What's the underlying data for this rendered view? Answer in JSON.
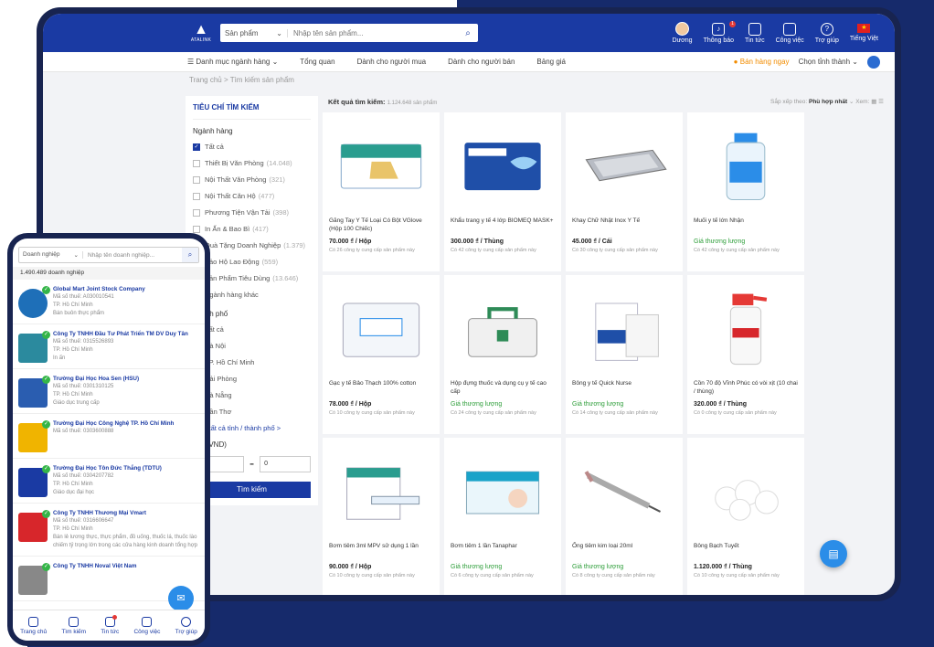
{
  "header": {
    "logo": "ATALINK",
    "search_category": "Sản phẩm",
    "search_placeholder": "Nhập tên sản phẩm...",
    "user": "Dương",
    "notifications": "Thông báo",
    "notification_count": "1",
    "news": "Tin tức",
    "jobs": "Công việc",
    "help": "Trợ giúp",
    "language": "Tiếng Việt"
  },
  "nav": {
    "items": [
      "Danh mục ngành hàng",
      "Tổng quan",
      "Dành cho người mua",
      "Dành cho người bán",
      "Bảng giá"
    ],
    "sell": "Bán hàng ngay",
    "city": "Chọn tỉnh thành"
  },
  "breadcrumb": "Trang chủ > Tìm kiếm sản phẩm",
  "filter": {
    "title": "TIÊU CHÍ TÌM KIẾM",
    "industry_label": "Ngành hàng",
    "all": "Tất cả",
    "industries": [
      {
        "name": "Thiết Bị Văn Phòng",
        "count": "(14.048)"
      },
      {
        "name": "Nội Thất Văn Phòng",
        "count": "(321)"
      },
      {
        "name": "Nội Thất Căn Hộ",
        "count": "(477)"
      },
      {
        "name": "Phương Tiện Vận Tải",
        "count": "(398)"
      },
      {
        "name": "In Ấn & Bao Bì",
        "count": "(417)"
      },
      {
        "name": "Quà Tặng Doanh Nghiệp",
        "count": "(1.379)"
      },
      {
        "name": "Bảo Hộ Lao Động",
        "count": "(559)"
      },
      {
        "name": "Sản Phẩm Tiêu Dùng",
        "count": "(13.646)"
      }
    ],
    "other_industry": "Ngành hàng khác",
    "city_label": "Thành phố",
    "cities": [
      "Tất cả",
      "Hà Nội",
      "TP. Hồ Chí Minh",
      "Hải Phòng",
      "Đà Nẵng",
      "Cần Thơ"
    ],
    "view_all_cities": "Xem tất cả tỉnh / thành phố >",
    "price_label": "Giá (VND)",
    "price_to": "0",
    "submit": "Tìm kiếm"
  },
  "results": {
    "label": "Kết quả tìm kiếm:",
    "count": "1.124.648 sản phẩm",
    "sort_label": "Sắp xếp theo:",
    "sort_value": "Phù hợp nhất",
    "view_label": "Xem:"
  },
  "products": [
    {
      "name": "Găng Tay Y Tế Loại Có Bột VGlove (Hộp 100 Chiếc)",
      "price": "70.000 ₫ / Hộp",
      "suppliers": "Có 26 công ty cung cấp sản phẩm này",
      "negotiable": false,
      "icon": "glove-box"
    },
    {
      "name": "Khẩu trang y tế 4 lớp BIOMEQ MASK+",
      "price": "300.000 ₫ / Thùng",
      "suppliers": "Có 42 công ty cung cấp sản phẩm này",
      "negotiable": false,
      "icon": "mask-box"
    },
    {
      "name": "Khay Chữ Nhật Inox Y Tế",
      "price": "45.000 ₫ / Cái",
      "suppliers": "Có 30 công ty cung cấp sản phẩm này",
      "negotiable": false,
      "icon": "steel-tray"
    },
    {
      "name": "Muối y tế lớn Nhận",
      "price": "Giá thương lượng",
      "suppliers": "Có 42 công ty cung cấp sản phẩm này",
      "negotiable": true,
      "icon": "saline-bottle"
    },
    {
      "name": "Gạc y tế Bảo Thạch 100% cotton",
      "price": "78.000 ₫ / Hộp",
      "suppliers": "Có 10 công ty cung cấp sản phẩm này",
      "negotiable": false,
      "icon": "gauze-pack"
    },
    {
      "name": "Hộp đựng thuốc và dụng cụ y tế cao cấp",
      "price": "Giá thương lượng",
      "suppliers": "Có 24 công ty cung cấp sản phẩm này",
      "negotiable": true,
      "icon": "medicine-box"
    },
    {
      "name": "Bông y tế Quick Nurse",
      "price": "Giá thương lượng",
      "suppliers": "Có 14 công ty cung cấp sản phẩm này",
      "negotiable": true,
      "icon": "cotton-pack"
    },
    {
      "name": "Cồn 70 độ Vĩnh Phúc có vòi xịt (10 chai / thùng)",
      "price": "320.000 ₫ / Thùng",
      "suppliers": "Có 0 công ty cung cấp sản phẩm này",
      "negotiable": false,
      "icon": "spray-bottle"
    },
    {
      "name": "Bơm tiêm 3ml MPV sử dụng 1 lần",
      "price": "90.000 ₫ / Hộp",
      "suppliers": "Có 10 công ty cung cấp sản phẩm này",
      "negotiable": false,
      "icon": "syringe-box"
    },
    {
      "name": "Bơm tiêm 1 lần Tanaphar",
      "price": "Giá thương lượng",
      "suppliers": "Có 6 công ty cung cấp sản phẩm này",
      "negotiable": true,
      "icon": "tanaphar-box"
    },
    {
      "name": "Ống tiêm kim loại 20ml",
      "price": "Giá thương lượng",
      "suppliers": "Có 8 công ty cung cấp sản phẩm này",
      "negotiable": true,
      "icon": "metal-syringe"
    },
    {
      "name": "Bông Bạch Tuyết",
      "price": "1.120.000 ₫ / Thùng",
      "suppliers": "Có 10 công ty cung cấp sản phẩm này",
      "negotiable": false,
      "icon": "cotton-balls"
    }
  ],
  "mobile": {
    "search_category": "Doanh nghiệp",
    "search_placeholder": "Nhập tên doanh nghiệp...",
    "count": "1.490.489 doanh nghiệp",
    "companies": [
      {
        "name": "Global Mart Joint Stock Company",
        "tax": "Mã số thuế: A030010541",
        "city": "TP. Hồ Chí Minh",
        "desc": "Bán buôn thực phẩm",
        "color": "#1e6fb8"
      },
      {
        "name": "Công Ty TNHH Đầu Tư Phát Triển TM DV Duy Tân",
        "tax": "Mã số thuế: 0315526893",
        "city": "TP. Hồ Chí Minh",
        "desc": "In ấn",
        "color": "#2b8a9e"
      },
      {
        "name": "Trường Đại Học Hoa Sen (HSU)",
        "tax": "Mã số thuế: 0301310125",
        "city": "TP. Hồ Chí Minh",
        "desc": "Giáo dục trung cấp",
        "color": "#2a5db0"
      },
      {
        "name": "Trường Đại Học Công Nghệ TP. Hồ Chí Minh",
        "tax": "Mã số thuế: 0303600888",
        "city": "",
        "desc": "",
        "color": "#f0b400"
      },
      {
        "name": "Trường Đại Học Tôn Đức Thắng (TDTU)",
        "tax": "Mã số thuế: 0304207782",
        "city": "TP. Hồ Chí Minh",
        "desc": "Giáo dục đại học",
        "color": "#1a3aa3"
      },
      {
        "name": "Công Ty TNHH Thương Mại Vmart",
        "tax": "Mã số thuế: 0316606647",
        "city": "TP. Hồ Chí Minh",
        "desc": "Bán lẻ lương thực, thực phẩm, đồ uống, thuốc lá, thuốc lào chiếm tỷ trọng lớn trong các cửa hàng kinh doanh tổng hợp",
        "color": "#d7262b"
      },
      {
        "name": "Công Ty TNHH Noval Việt Nam",
        "tax": "",
        "city": "",
        "desc": "",
        "color": "#888888"
      }
    ],
    "tabs": [
      "Trang chủ",
      "Tìm kiếm",
      "Tin tức",
      "Công việc",
      "Trợ giúp"
    ]
  }
}
